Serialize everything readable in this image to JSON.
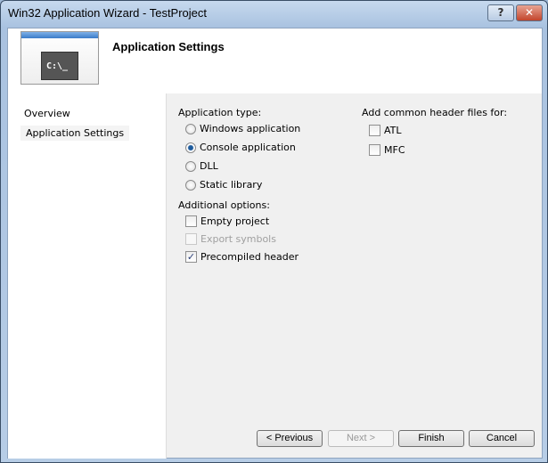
{
  "window": {
    "title": "Win32 Application Wizard - TestProject",
    "help": "?",
    "close": "✕"
  },
  "header": {
    "title": "Application Settings",
    "logo_text": "C:\\_"
  },
  "nav": [
    {
      "label": "Overview"
    },
    {
      "label": "Application Settings"
    }
  ],
  "app_type": {
    "label": "Application type:",
    "options": [
      {
        "label": "Windows application",
        "selected": false
      },
      {
        "label": "Console application",
        "selected": true
      },
      {
        "label": "DLL",
        "selected": false
      },
      {
        "label": "Static library",
        "selected": false
      }
    ]
  },
  "additional": {
    "label": "Additional options:",
    "options": [
      {
        "label": "Empty project",
        "checked": false,
        "enabled": true
      },
      {
        "label": "Export symbols",
        "checked": false,
        "enabled": false
      },
      {
        "label": "Precompiled header",
        "checked": true,
        "enabled": true
      }
    ]
  },
  "headers": {
    "label": "Add common header files for:",
    "options": [
      {
        "label": "ATL",
        "checked": false
      },
      {
        "label": "MFC",
        "checked": false
      }
    ]
  },
  "buttons": {
    "previous": "< Previous",
    "next": "Next >",
    "finish": "Finish",
    "cancel": "Cancel"
  }
}
